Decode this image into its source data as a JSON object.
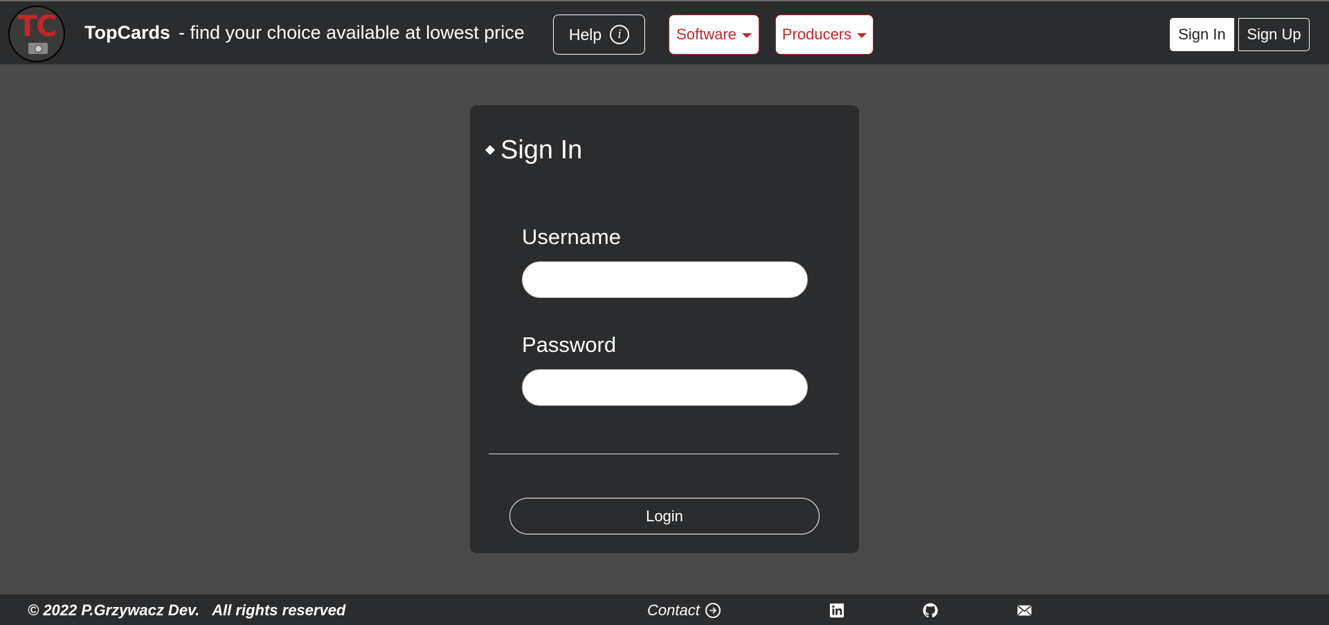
{
  "navbar": {
    "brand_name": "TopCards",
    "tagline": "- find your choice available at lowest price",
    "logo_text": "TC",
    "help_label": "Help",
    "software_label": "Software",
    "producers_label": "Producers",
    "signin_label": "Sign In",
    "signup_label": "Sign Up"
  },
  "form": {
    "title": "Sign In",
    "username_label": "Username",
    "username_value": "",
    "password_label": "Password",
    "password_value": "",
    "login_label": "Login"
  },
  "footer": {
    "copyright": "© 2022 P.Grzywacz Dev.",
    "rights": "All rights reserved",
    "contact_label": "Contact"
  },
  "colors": {
    "accent": "#c0282d",
    "navbar_bg": "#2b2c2e",
    "page_bg": "#4a4a4a"
  },
  "icons": [
    "info-icon",
    "caret-down-icon",
    "arrow-right-circle-icon",
    "linkedin-icon",
    "github-icon",
    "mail-icon"
  ]
}
